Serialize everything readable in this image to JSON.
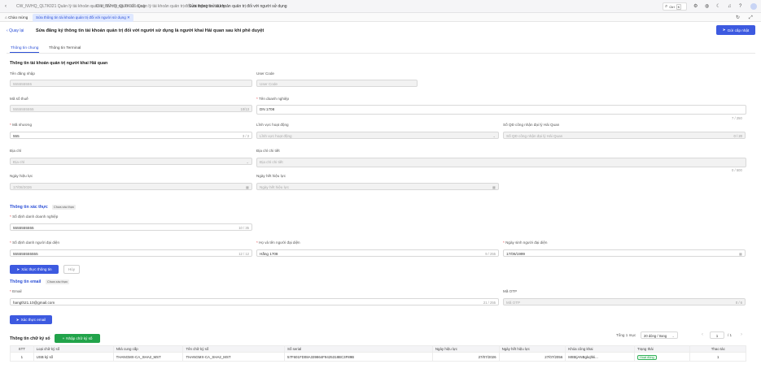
{
  "topbar": {
    "breadcrumbs": [
      "CW_NVHQ_QLTK021 Quản lý tài khoản quản trị đối với người sử dụng",
      "CW_NVHQ_QLTK021 Quản lý tài khoản quản trị đối với người sử dụng",
      "Sửa thông tin tài khoản quản trị đối với người sử dụng"
    ],
    "search_label": "Ctrl",
    "search_key": "K"
  },
  "tabs": {
    "home": "Chào mừng",
    "active": "Sửa thông tin tài khoản quản trị đối với người sử dụng"
  },
  "header": {
    "back": "Quay lại",
    "title": "Sửa đăng ký thông tin tài khoản quản trị đối với người sử dụng là người khai Hải quan sau khi phê duyệt",
    "submit": "Gửi cấp nhật"
  },
  "subtabs": [
    "Thông tin chung",
    "Thông tin Terminal"
  ],
  "section1": {
    "title": "Thông tin tài khoản quản trị người khai Hải quan",
    "username_label": "Tên đăng nhập",
    "username_value": "555555555",
    "usercode_label": "User Code",
    "usercode_placeholder": "User Code",
    "taxcode_label": "Mã số thuế",
    "taxcode_value": "5555555555",
    "taxcode_count": "10/13",
    "company_label": "Tên doanh nghiệp",
    "company_value": "DN 1708",
    "company_count": "7 / 250",
    "seal_label": "Mã nhương",
    "seal_value": "555",
    "seal_count": "3 / 3",
    "field_label": "Lĩnh vực hoạt động",
    "field_placeholder": "Lĩnh vực hoạt động",
    "decision_label": "Số QĐ công nhận đại lý Hải Quan",
    "decision_placeholder": "Số QĐ công nhận đại lý Hải Quan",
    "decision_count": "0 / 20",
    "address_label": "Địa chỉ",
    "address_placeholder": "Địa chỉ",
    "address_detail_label": "Địa chỉ chi tiết",
    "address_detail_placeholder": "Địa chỉ chi tiết",
    "address_detail_count": "0 / 500",
    "effective_label": "Ngày hiệu lực",
    "effective_value": "17/08/2026",
    "expiry_label": "Ngày hết hiệu lực",
    "expiry_placeholder": "Ngày hết hiệu lực"
  },
  "verify": {
    "title": "Thông tin xác thực",
    "status": "Chưa xác thực",
    "enterprise_id_label": "Số định danh doanh nghiệp",
    "enterprise_id_value": "5555555555",
    "enterprise_id_count": "10 / 35",
    "rep_id_label": "Số định danh người đại diện",
    "rep_id_value": "555555555555",
    "rep_id_count": "12 / 12",
    "rep_name_label": "Họ và tên người đại diện",
    "rep_name_value": "Hằng 1708",
    "rep_name_count": "9 / 255",
    "rep_dob_label": "Ngày sinh người đại diện",
    "rep_dob_value": "17/06/1999",
    "verify_btn": "Xác thực thông tin",
    "undo_btn": "Hủy"
  },
  "email": {
    "title": "Thông tin email",
    "status": "Chưa xác thực",
    "email_label": "Email",
    "email_value": "hangth21.10@gmail.com",
    "email_count": "21 / 255",
    "otp_label": "Mã OTP",
    "otp_placeholder": "Mã OTP",
    "otp_count": "0 / 6",
    "verify_btn": "Xác thực email"
  },
  "signature": {
    "title": "Thông tin chữ ký số",
    "add_btn": "Nhập chữ ký số",
    "total": "Tổng 1 mục",
    "page_size": "20 dòng / trang",
    "page": "1",
    "page_total": "/ 1",
    "columns": [
      "STT",
      "Loại chữ ký số",
      "Nhà cung cấp",
      "Tên chữ ký số",
      "Số serial",
      "Ngày hiệu lực",
      "Ngày hết hiệu lực",
      "Khóa công khai",
      "Trạng thái",
      "Thao tác"
    ],
    "rows": [
      [
        "1",
        "USB ký số",
        "THANGMX-CA_SHA2_MST",
        "THANGMX-CA_SHA2_MST",
        "57F601FD08A339864F9425318BC3F89B",
        "27/07/2026",
        "27/07/2056",
        "MIIBIjANBgkqhki...",
        "Hoạt động",
        "1"
      ]
    ]
  },
  "colors": {
    "primary": "#3d5ae0",
    "green": "#21a34a",
    "red": "#e0393e"
  }
}
